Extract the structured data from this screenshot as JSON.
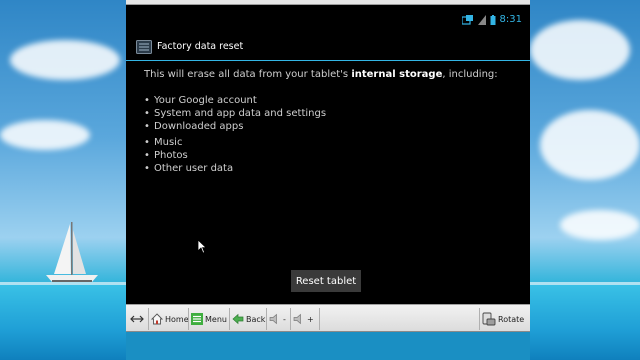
{
  "status": {
    "time": "8:31",
    "icons": [
      "network-icon",
      "signal-icon",
      "battery-icon"
    ]
  },
  "actionbar": {
    "title": "Factory data reset",
    "icon": "settings-icon"
  },
  "content": {
    "intro_prefix": "This will erase all data from your tablet's ",
    "intro_bold": "internal storage",
    "intro_suffix": ", including:",
    "items": [
      "Your Google account",
      "System and app data and settings",
      "Downloaded apps",
      "Music",
      "Photos",
      "Other user data"
    ],
    "reset_button": "Reset tablet"
  },
  "toolbar": {
    "home": "Home",
    "menu": "Menu",
    "back": "Back",
    "vol_down": "-",
    "vol_up": "+",
    "rotate": "Rotate"
  },
  "colors": {
    "accent": "#33b5e5",
    "screen_bg": "#000000",
    "button_bg": "#3a3a3a"
  }
}
